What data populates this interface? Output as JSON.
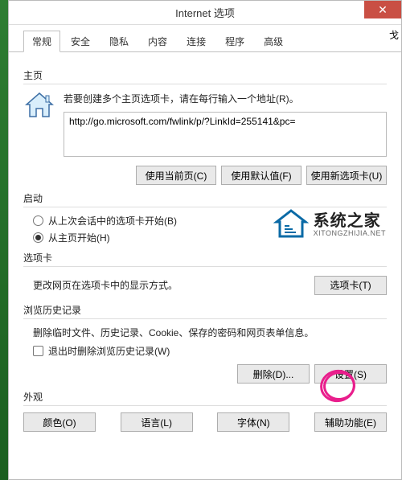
{
  "title": "Internet 选项",
  "tabs": [
    "常规",
    "安全",
    "隐私",
    "内容",
    "连接",
    "程序",
    "高级"
  ],
  "active_tab": 0,
  "stray_char": "戈",
  "section_home": "主页",
  "home_text": "若要创建多个主页选项卡，请在每行输入一个地址(R)。",
  "url_value": "http://go.microsoft.com/fwlink/p/?LinkId=255141&pc=",
  "btn_current": "使用当前页(C)",
  "btn_default": "使用默认值(F)",
  "btn_newtab": "使用新选项卡(U)",
  "section_startup": "启动",
  "radio_last": "从上次会话中的选项卡开始(B)",
  "radio_home": "从主页开始(H)",
  "section_tabs": "选项卡",
  "tabs_desc": "更改网页在选项卡中的显示方式。",
  "btn_tabs": "选项卡(T)",
  "section_history": "浏览历史记录",
  "history_desc": "删除临时文件、历史记录、Cookie、保存的密码和网页表单信息。",
  "chk_exit_delete": "退出时删除浏览历史记录(W)",
  "btn_delete": "删除(D)...",
  "btn_settings": "设置(S)",
  "section_appearance": "外观",
  "btn_color": "颜色(O)",
  "btn_lang": "语言(L)",
  "btn_font": "字体(N)",
  "btn_access": "辅助功能(E)",
  "watermark": {
    "big": "系统之家",
    "small": "XITONGZHIJIA.NET"
  }
}
